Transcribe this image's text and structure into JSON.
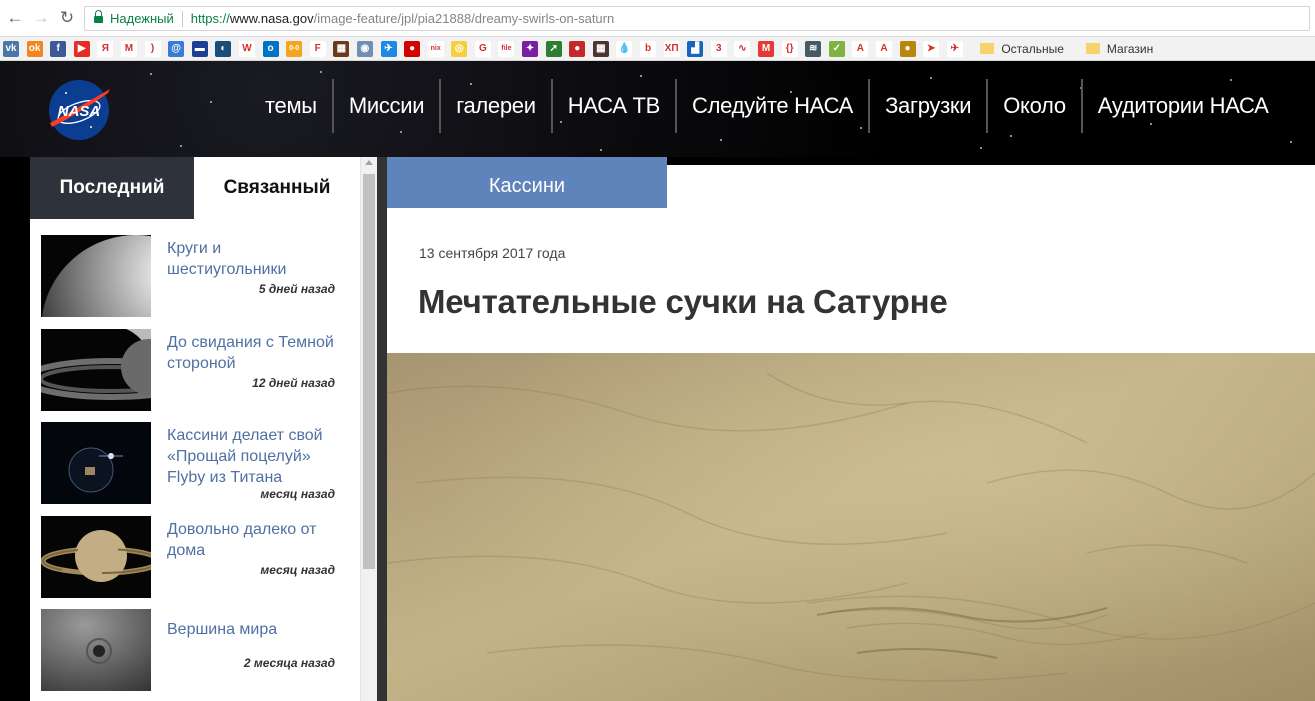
{
  "browser": {
    "back_icon": "arrow-left-icon",
    "forward_icon": "arrow-right-icon",
    "reload_icon": "reload-icon",
    "secure_label": "Надежный",
    "url_proto": "https://",
    "url_host": "www.nasa.gov",
    "url_path": "/image-feature/jpl/pia21888/dreamy-swirls-on-saturn"
  },
  "bookmarks": {
    "icons": [
      {
        "name": "vk-icon",
        "glyph": "vk",
        "color": "#4a76a8"
      },
      {
        "name": "odnoklassniki-icon",
        "glyph": "ok",
        "color": "#f2851e"
      },
      {
        "name": "facebook-icon",
        "glyph": "f",
        "color": "#3b5998"
      },
      {
        "name": "youtube-icon",
        "glyph": "▶",
        "color": "#e52d27"
      },
      {
        "name": "yandex-icon",
        "glyph": "Я",
        "color": "#ffffff"
      },
      {
        "name": "gmail-icon",
        "glyph": "M",
        "color": "#ffffff"
      },
      {
        "name": "opera-icon",
        "glyph": ")",
        "color": "#ffffff"
      },
      {
        "name": "mail-icon",
        "glyph": "@",
        "color": "#3a7bd5"
      },
      {
        "name": "card-icon",
        "glyph": "▬",
        "color": "#1c3f94"
      },
      {
        "name": "globe-icon",
        "glyph": "◐",
        "color": "#1b4d7a"
      },
      {
        "name": "wikipedia-icon",
        "glyph": "W",
        "color": "#ffffff"
      },
      {
        "name": "outlook-icon",
        "glyph": "o",
        "color": "#0072c6"
      },
      {
        "name": "zero-icon",
        "glyph": "0-0",
        "color": "#f4a51c"
      },
      {
        "name": "f-bracket-icon",
        "glyph": "F",
        "color": "#ffffff"
      },
      {
        "name": "game-icon",
        "glyph": "▦",
        "color": "#6b3a1e"
      },
      {
        "name": "app-icon",
        "glyph": "◉",
        "color": "#6f8fb4"
      },
      {
        "name": "plane-icon",
        "glyph": "✈",
        "color": "#1e88e5"
      },
      {
        "name": "pacman-icon",
        "glyph": "●",
        "color": "#d50000"
      },
      {
        "name": "nix-icon",
        "glyph": "nix",
        "color": "#ffffff"
      },
      {
        "name": "target-icon",
        "glyph": "◎",
        "color": "#f4d03f"
      },
      {
        "name": "google-icon",
        "glyph": "G",
        "color": "#ffffff"
      },
      {
        "name": "file-icon",
        "glyph": "file",
        "color": "#ffffff"
      },
      {
        "name": "puzzle-icon",
        "glyph": "✦",
        "color": "#7b1fa2"
      },
      {
        "name": "arrow-icon",
        "glyph": "➚",
        "color": "#2e7d32"
      },
      {
        "name": "ball-icon",
        "glyph": "●",
        "color": "#c62828"
      },
      {
        "name": "game2-icon",
        "glyph": "▦",
        "color": "#4e342e"
      },
      {
        "name": "drop-icon",
        "glyph": "💧",
        "color": "#ffffff"
      },
      {
        "name": "b-icon",
        "glyph": "b",
        "color": "#ffffff"
      },
      {
        "name": "xp-icon",
        "glyph": "ХП",
        "color": "#ffffff"
      },
      {
        "name": "chart-icon",
        "glyph": "▟",
        "color": "#1565c0"
      },
      {
        "name": "three-icon",
        "glyph": "3",
        "color": "#ffffff"
      },
      {
        "name": "wave-icon",
        "glyph": "∿",
        "color": "#ffffff"
      },
      {
        "name": "m-icon",
        "glyph": "M",
        "color": "#e53935"
      },
      {
        "name": "brackets-icon",
        "glyph": "{}",
        "color": "#ffffff"
      },
      {
        "name": "stack-icon",
        "glyph": "≋",
        "color": "#455a64"
      },
      {
        "name": "check-icon",
        "glyph": "✓",
        "color": "#7cb342"
      },
      {
        "name": "a-blue-icon",
        "glyph": "A",
        "color": "#ffffff"
      },
      {
        "name": "a-red-icon",
        "glyph": "A",
        "color": "#ffffff"
      },
      {
        "name": "cookie-icon",
        "glyph": "●",
        "color": "#b8860b"
      },
      {
        "name": "jet-icon",
        "glyph": "➤",
        "color": "#ffffff"
      },
      {
        "name": "paperplane-icon",
        "glyph": "✈",
        "color": "#ffffff"
      }
    ],
    "folder_other": "Остальные",
    "folder_shop": "Магазин"
  },
  "header": {
    "logo_text": "NASA",
    "nav": [
      "темы",
      "Миссии",
      "галереи",
      "НАСА ТВ",
      "Следуйте НАСА",
      "Загрузки",
      "Около",
      "Аудитории НАСА"
    ]
  },
  "sidebar": {
    "tab_latest": "Последний",
    "tab_related": "Связанный",
    "items": [
      {
        "title": "Круги и шестиугольники",
        "time": "5 дней назад"
      },
      {
        "title": "До свидания с Темной стороной",
        "time": "12 дней назад"
      },
      {
        "title": "Кассини делает свой «Прощай поцелуй» Flyby из Титана",
        "time": "месяц назад"
      },
      {
        "title": "Довольно далеко от дома",
        "time": "месяц назад"
      },
      {
        "title": "Вершина мира",
        "time": "2 месяца назад"
      }
    ]
  },
  "article": {
    "topic": "Кассини",
    "date": "13 сентября 2017 года",
    "title": "Мечтательные сучки на Сатурне"
  }
}
